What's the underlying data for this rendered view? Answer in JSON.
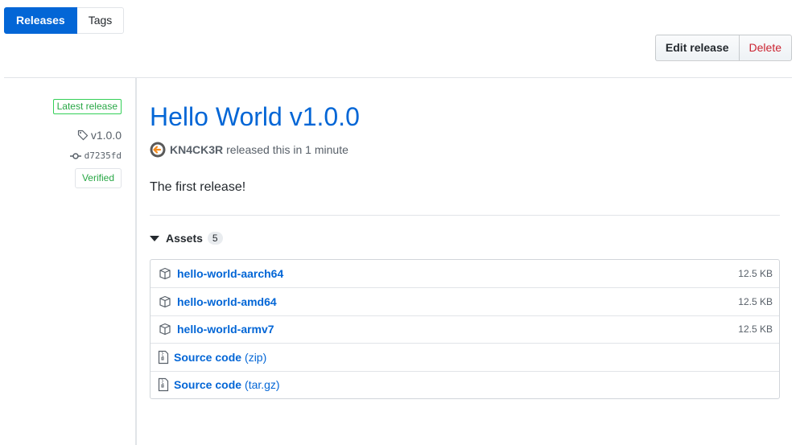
{
  "tabs": {
    "releases": "Releases",
    "tags": "Tags"
  },
  "actions": {
    "edit": "Edit release",
    "delete": "Delete"
  },
  "meta": {
    "latest": "Latest release",
    "tag": "v1.0.0",
    "commit": "d7235fd",
    "verified": "Verified"
  },
  "release": {
    "title": "Hello World v1.0.0",
    "author": "KN4CK3R",
    "released_text": "released this in 1 minute",
    "body": "The first release!"
  },
  "assets": {
    "heading": "Assets",
    "count": "5",
    "files": [
      {
        "name": "hello-world-aarch64",
        "size": "12.5 KB",
        "icon": "package-icon"
      },
      {
        "name": "hello-world-amd64",
        "size": "12.5 KB",
        "icon": "package-icon"
      },
      {
        "name": "hello-world-armv7",
        "size": "12.5 KB",
        "icon": "package-icon"
      }
    ],
    "sources": [
      {
        "name": "Source code",
        "format": "(zip)",
        "icon": "file-zip-icon"
      },
      {
        "name": "Source code",
        "format": "(tar.gz)",
        "icon": "file-zip-icon"
      }
    ]
  },
  "colors": {
    "link": "#0366d6",
    "verified": "#28a745",
    "danger": "#cb2431",
    "avatar_accent": "#f38a1c"
  }
}
